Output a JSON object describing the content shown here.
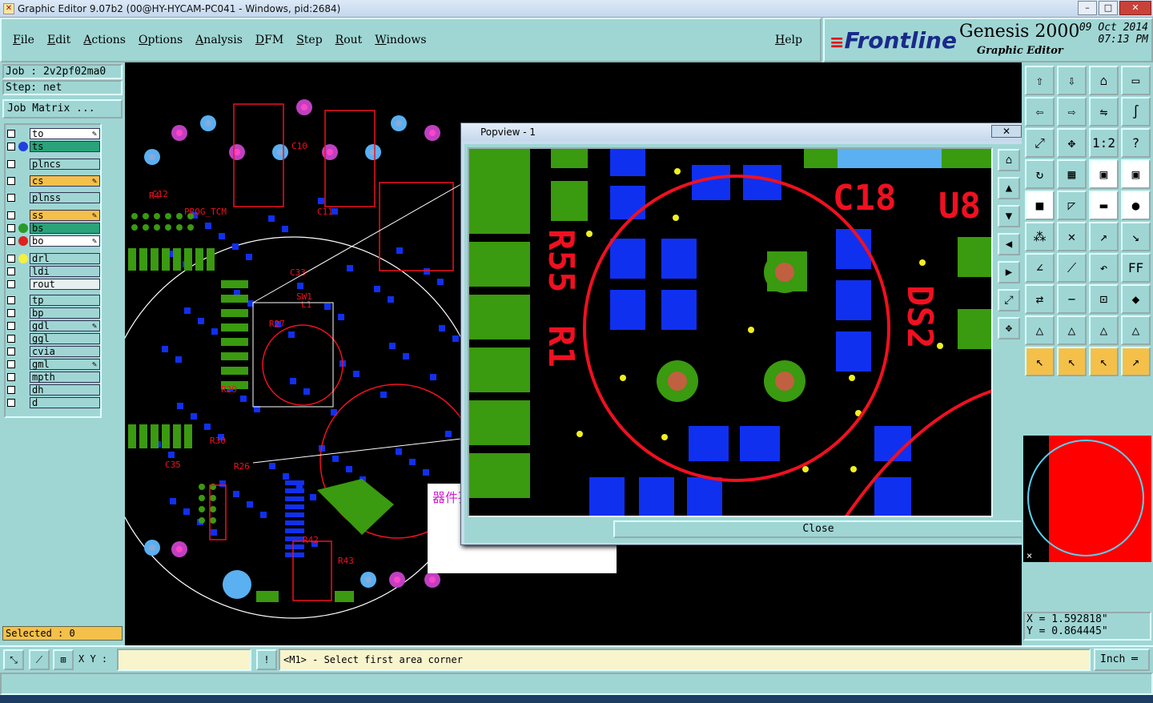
{
  "window": {
    "title": "Graphic Editor 9.07b2 (00@HY-HYCAM-PC041 - Windows, pid:2684)"
  },
  "menu": [
    "File",
    "Edit",
    "Actions",
    "Options",
    "Analysis",
    "DFM",
    "Step",
    "Rout",
    "Windows"
  ],
  "help_label": "Help",
  "brand": {
    "logo": "Frontline",
    "product": "Genesis 2000",
    "subtitle": "Graphic Editor",
    "date": "09 Oct 2014",
    "time": "07:13 PM"
  },
  "job": {
    "job_label": "Job : 2v2pf02ma0",
    "step_label": "Step: net",
    "job_matrix": "Job Matrix ..."
  },
  "layers": [
    {
      "name": "to",
      "bg": "#ffffff",
      "dot": "",
      "edit": true
    },
    {
      "name": "ts",
      "bg": "#2aa37a",
      "dot": "#2040e0",
      "edit": false
    },
    {
      "name": "plncs",
      "bg": "#9fd6d4",
      "dot": "",
      "edit": false
    },
    {
      "name": "cs",
      "bg": "#f4c04a",
      "dot": "",
      "edit": true
    },
    {
      "name": "plnss",
      "bg": "#9fd6d4",
      "dot": "",
      "edit": false
    },
    {
      "name": "ss",
      "bg": "#f4c04a",
      "dot": "",
      "edit": true
    },
    {
      "name": "bs",
      "bg": "#2aa37a",
      "dot": "#2a9a2a",
      "edit": false
    },
    {
      "name": "bo",
      "bg": "#ffffff",
      "dot": "#e02020",
      "edit": true
    },
    {
      "name": "drl",
      "bg": "#9fd6d4",
      "dot": "#f4f040",
      "edit": false
    },
    {
      "name": "ldi",
      "bg": "#9fd6d4",
      "dot": "",
      "edit": false
    },
    {
      "name": "rout",
      "bg": "#e6f0f0",
      "dot": "",
      "edit": false
    },
    {
      "name": "tp",
      "bg": "#9fd6d4",
      "dot": "",
      "edit": false
    },
    {
      "name": "bp",
      "bg": "#9fd6d4",
      "dot": "",
      "edit": false
    },
    {
      "name": "gdl",
      "bg": "#9fd6d4",
      "dot": "",
      "edit": true
    },
    {
      "name": "ggl",
      "bg": "#9fd6d4",
      "dot": "",
      "edit": false
    },
    {
      "name": "cvia",
      "bg": "#9fd6d4",
      "dot": "",
      "edit": false
    },
    {
      "name": "gml",
      "bg": "#9fd6d4",
      "dot": "",
      "edit": true
    },
    {
      "name": "mpth",
      "bg": "#9fd6d4",
      "dot": "",
      "edit": false
    },
    {
      "name": "dh",
      "bg": "#9fd6d4",
      "dot": "",
      "edit": false
    },
    {
      "name": "d",
      "bg": "#9fd6d4",
      "dot": "",
      "edit": false
    }
  ],
  "selected": "Selected : 0",
  "popview": {
    "title": "Popview - 1",
    "close": "Close"
  },
  "annotation": "器件孔漏开窗",
  "coords": {
    "x": "X = 1.592818\"",
    "y": "Y = 0.864445\""
  },
  "bottom": {
    "xy_label": "X Y :",
    "xy_value": "",
    "prompt": "<M1> - Select first area corner",
    "unit": "Inch"
  },
  "board_labels": [
    "R55",
    "R1",
    "C18",
    "U8",
    "DS2",
    "C9",
    "R4",
    "U6",
    "C11",
    "C10",
    "L1",
    "C35",
    "R26",
    "R27",
    "R30",
    "R29",
    "C33",
    "SW1",
    "R43",
    "R42",
    "C12",
    "PROG_TCM"
  ],
  "colors": {
    "pad_blue": "#1030f0",
    "pad_green": "#3a9a10",
    "silk_red": "#f01020",
    "via_magenta": "#c040c0",
    "drill_yellow": "#f0f020"
  }
}
